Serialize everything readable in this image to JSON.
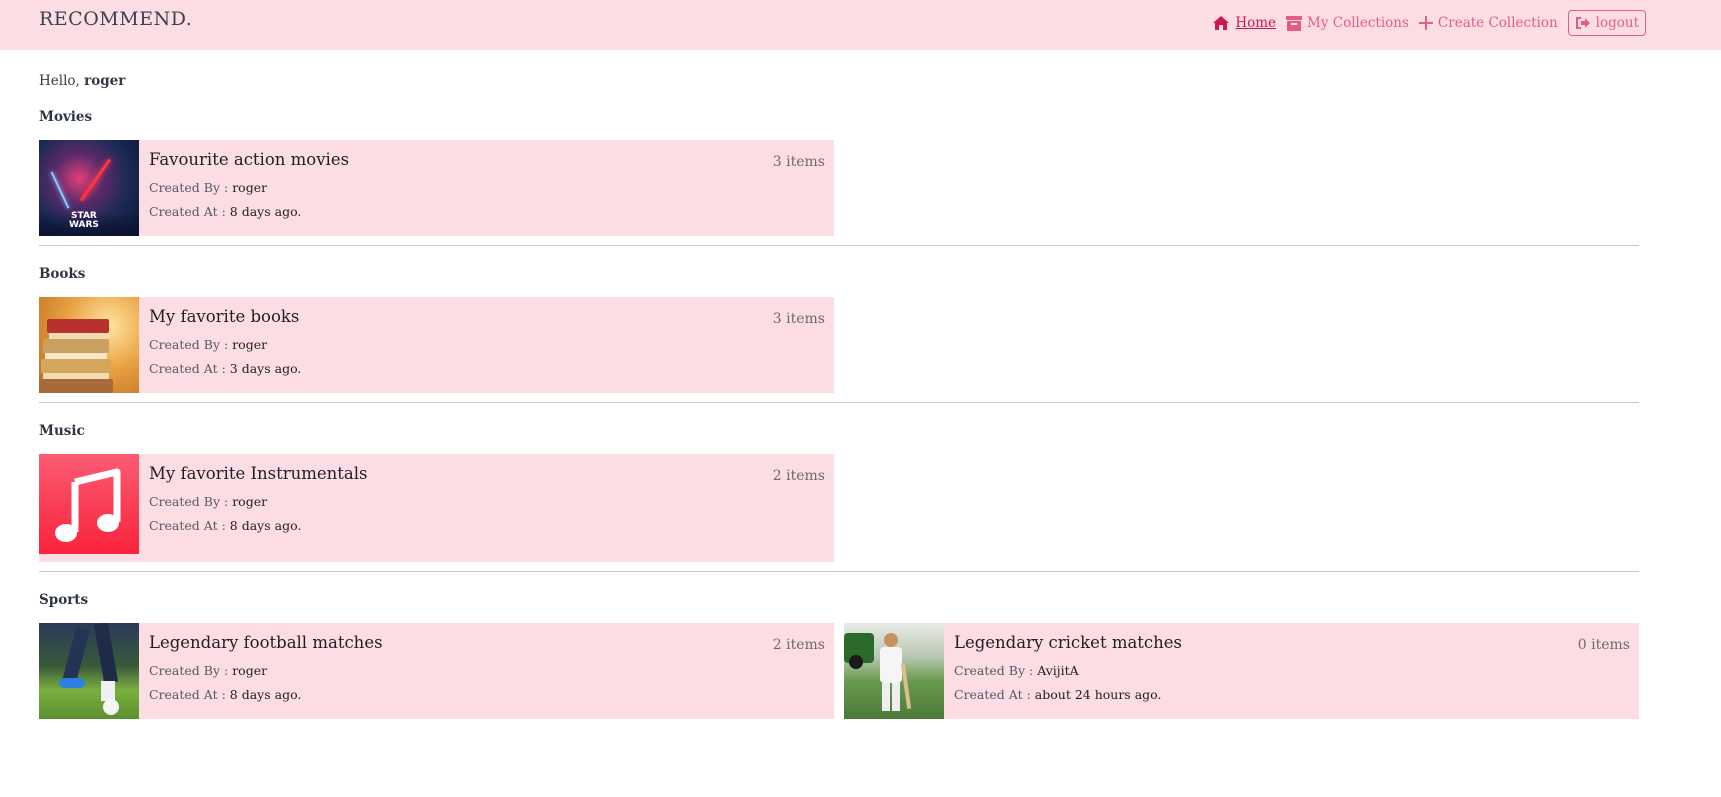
{
  "brand": "RECOMMEND.",
  "nav": {
    "home": "Home",
    "collections": "My Collections",
    "create": "Create Collection",
    "logout": "logout"
  },
  "greeting": {
    "prefix": "Hello,",
    "user": "roger"
  },
  "labels": {
    "created_by": "Created By :",
    "created_at": "Created At :"
  },
  "sections": [
    {
      "title": "Movies",
      "cards": [
        {
          "title": "Favourite action movies",
          "count": "3 items",
          "by": "roger",
          "at": "8 days ago.",
          "image": "star-wars-poster"
        }
      ]
    },
    {
      "title": "Books",
      "cards": [
        {
          "title": "My favorite books",
          "count": "3 items",
          "by": "roger",
          "at": "3 days ago.",
          "image": "books-stack"
        }
      ]
    },
    {
      "title": "Music",
      "cards": [
        {
          "title": "My favorite Instrumentals",
          "count": "2 items",
          "by": "roger",
          "at": "8 days ago.",
          "image": "music-note-icon"
        }
      ]
    },
    {
      "title": "Sports",
      "cards": [
        {
          "title": "Legendary football matches",
          "count": "2 items",
          "by": "roger",
          "at": "8 days ago.",
          "image": "football-player"
        },
        {
          "title": "Legendary cricket matches",
          "count": "0 items",
          "by": "AvijitA",
          "at": "about 24 hours ago.",
          "image": "cricket-player"
        }
      ]
    }
  ],
  "colors": {
    "navbar": "#fddde4",
    "card": "#fddde4",
    "accent": "#e45d84",
    "active": "#c81a4f"
  }
}
